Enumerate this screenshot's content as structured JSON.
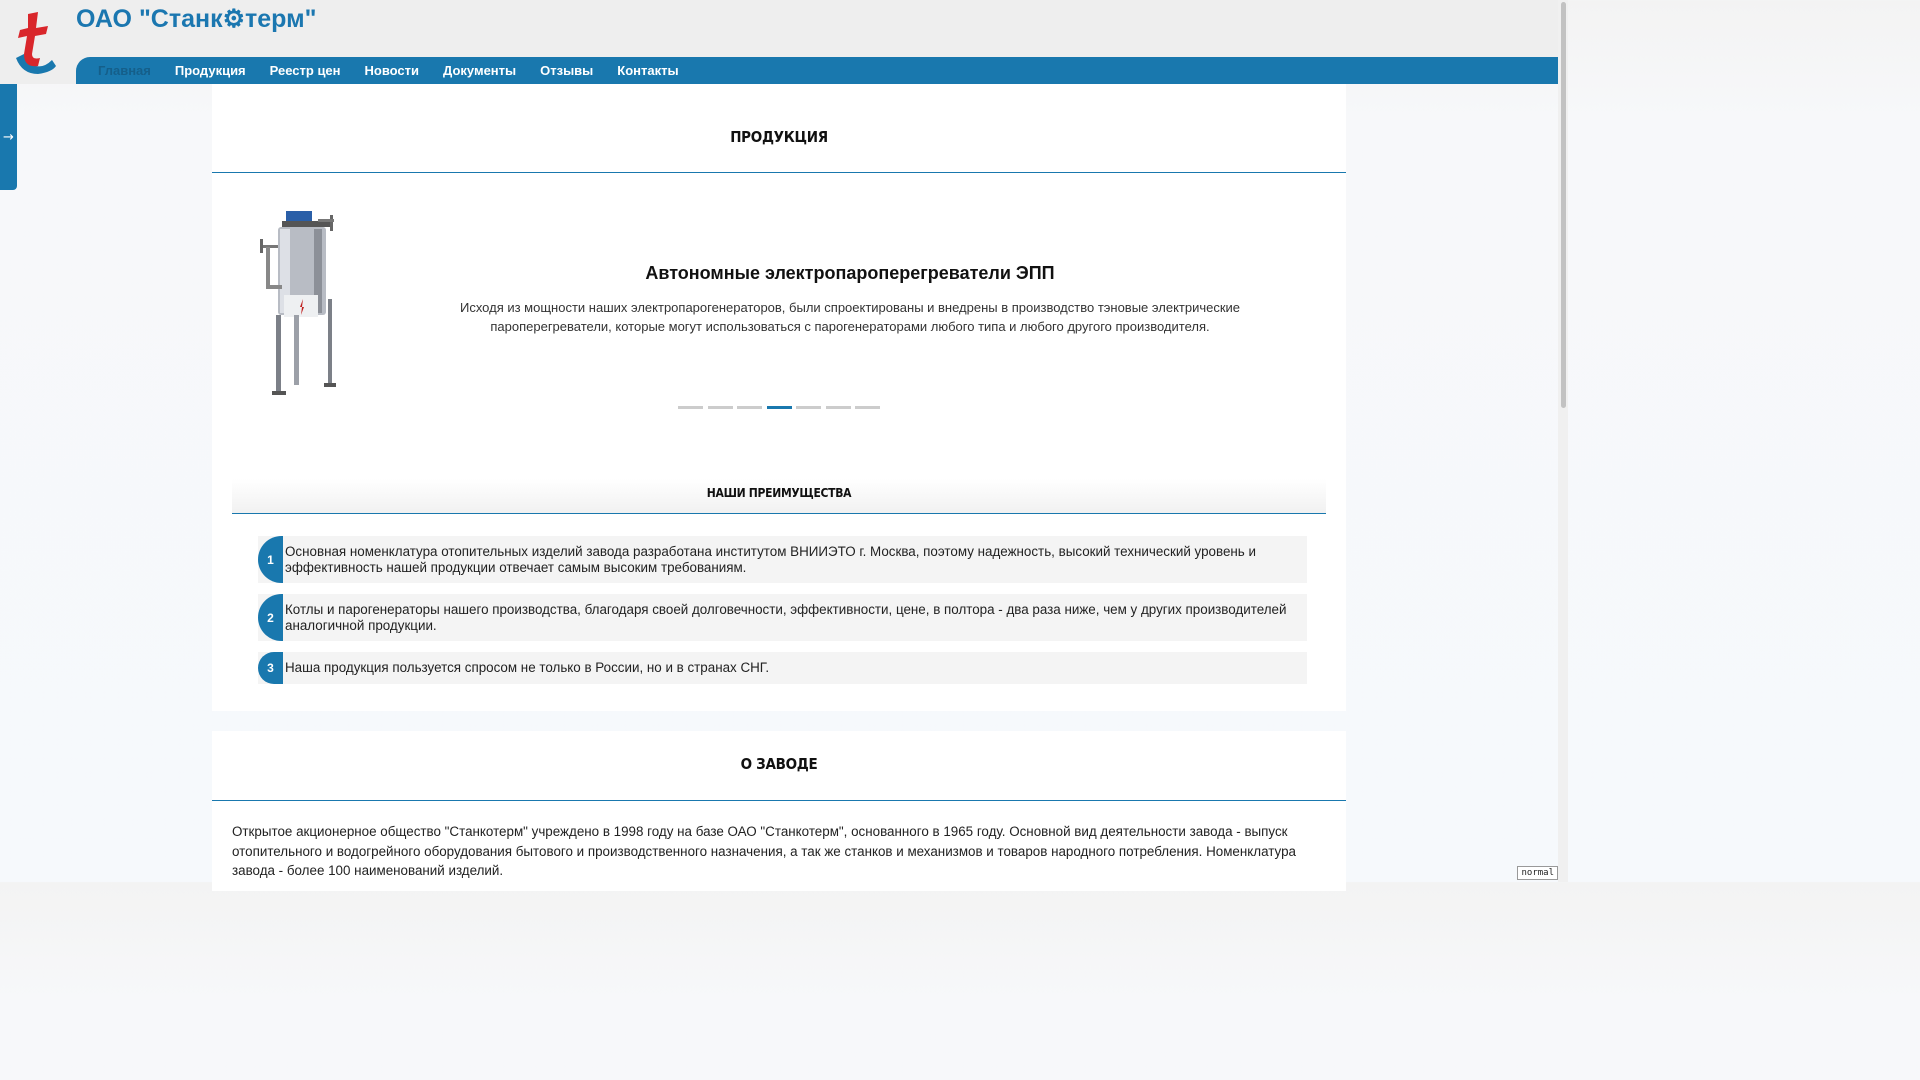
{
  "site": {
    "title": "ОАО \"Станк⚙терм\""
  },
  "nav": {
    "items": [
      {
        "label": "Главная"
      },
      {
        "label": "Продукция"
      },
      {
        "label": "Реестр цен"
      },
      {
        "label": "Новости"
      },
      {
        "label": "Документы"
      },
      {
        "label": "Отзывы"
      },
      {
        "label": "Контакты"
      }
    ],
    "active_index": 0
  },
  "side_tab": {
    "icon": "arrow-right-icon",
    "glyph": "→"
  },
  "products": {
    "heading": "Продукция",
    "slide": {
      "title": "Автономные электропароперегреватели ЭПП",
      "text": "Исходя из мощности наших электропарогенераторов, были спроектированы и внедрены в производство тэновые электрические пароперегреватели, которые могут использоваться с парогенераторами любого типа и любого другого производителя.",
      "image": "steam-superheater-image"
    },
    "slider": {
      "count": 7,
      "active_index": 3
    }
  },
  "advantages": {
    "heading": "Наши преимущества",
    "items": [
      {
        "num": "1",
        "text": "Основная номенклатура отопительных изделий завода разработана институтом ВНИИЭТО г. Москва, поэтому надежность, высокий технический уровень и эффективность нашей продукции отвечает самым высоким требованиям."
      },
      {
        "num": "2",
        "text": "Котлы и парогенераторы нашего производства, благодаря своей долговечности, эффективности, цене, в полтора - два раза ниже, чем у других производителей аналогичной продукции."
      },
      {
        "num": "3",
        "text": "Наша продукция пользуется спросом не только в России, но и в странах СНГ."
      }
    ]
  },
  "about": {
    "heading": "О заводе",
    "text": "Открытое акционерное общество \"Станкотерм\" учреждено в 1998 году на базе ОАО \"Станкотерм\", основанного в 1965 году. Основной вид деятельности завода - выпуск отопительного и водогрейного оборудования бытового и производственного назначения, а так же станков и механизмов и товаров народного потребления. Номенклатура завода - более 100 наименований изделий."
  },
  "badge": {
    "text": "normal"
  },
  "colors": {
    "accent": "#1978ae",
    "header_bg": "#eeeeee",
    "title": "#1b77b0"
  }
}
